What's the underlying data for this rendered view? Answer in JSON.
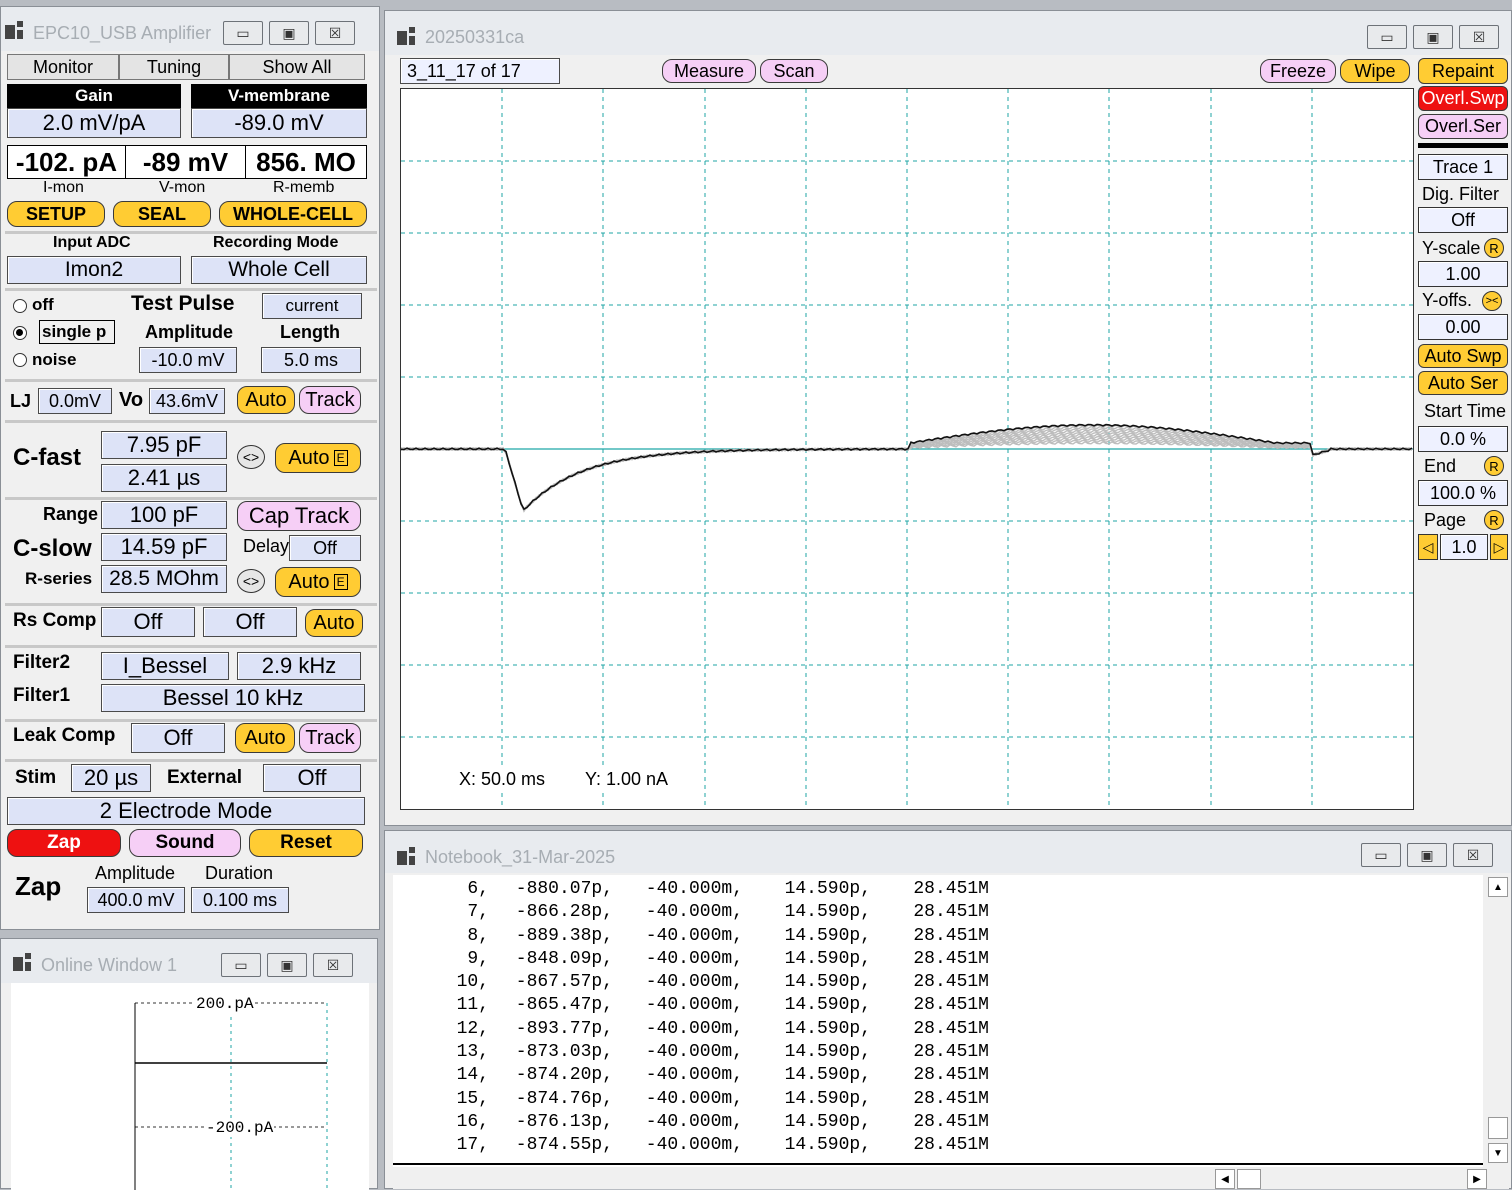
{
  "amplifier": {
    "title": "EPC10_USB Amplifier",
    "tabs": [
      "Monitor",
      "Tuning",
      "Show All"
    ],
    "gain_label": "Gain",
    "gain_value": "2.0 mV/pA",
    "vmem_label": "V-membrane",
    "vmem_value": "-89.0 mV",
    "imon_value": "-102. pA",
    "vmon_value": "-89 mV",
    "rmemb_value": "856. MO",
    "imon_label": "I-mon",
    "vmon_label": "V-mon",
    "rmemb_label": "R-memb",
    "mode_setup": "SETUP",
    "mode_seal": "SEAL",
    "mode_whole": "WHOLE-CELL",
    "input_adc_label": "Input ADC",
    "input_adc_value": "Imon2",
    "rec_mode_label": "Recording Mode",
    "rec_mode_value": "Whole Cell",
    "tp_off": "off",
    "tp_single": "single p",
    "tp_noise": "noise",
    "tp_title": "Test Pulse",
    "tp_current": "current",
    "tp_amp_label": "Amplitude",
    "tp_len_label": "Length",
    "tp_amp_value": "-10.0 mV",
    "tp_len_value": "5.0 ms",
    "lj_label": "LJ",
    "lj_value": "0.0mV",
    "vo_label": "Vo",
    "vo_value": "43.6mV",
    "auto": "Auto",
    "track": "Track",
    "cfast_label": "C-fast",
    "cfast_value": "7.95 pF",
    "cfast_tau": "2.41 µs",
    "arrows": "<>",
    "auto_e": "E",
    "range_label": "Range",
    "range_value": "100 pF",
    "cap_track": "Cap Track",
    "cslow_label": "C-slow",
    "cslow_value": "14.59 pF",
    "delay_label": "Delay",
    "delay_value": "Off",
    "rseries_label": "R-series",
    "rseries_value": "28.5 MOhm",
    "rscomp_label": "Rs Comp",
    "rscomp_value1": "Off",
    "rscomp_value2": "Off",
    "filter2_label": "Filter2",
    "filter2_type": "I_Bessel",
    "filter2_freq": "2.9 kHz",
    "filter1_label": "Filter1",
    "filter1_value": "Bessel 10 kHz",
    "leak_label": "Leak Comp",
    "leak_value": "Off",
    "stim_label": "Stim",
    "stim_value": "20 µs",
    "external_label": "External",
    "external_value": "Off",
    "electrode_mode": "2 Electrode Mode",
    "zap_btn": "Zap",
    "sound_btn": "Sound",
    "reset_btn": "Reset",
    "zap_label": "Zap",
    "zap_amp_label": "Amplitude",
    "zap_dur_label": "Duration",
    "zap_amp_value": "400.0 mV",
    "zap_dur_value": "0.100 ms"
  },
  "online": {
    "title": "Online Window 1",
    "top_label": "200.pA",
    "bottom_label": "-200.pA"
  },
  "oscilloscope": {
    "title": "20250331ca",
    "series": "3_11_17 of 17",
    "measure": "Measure",
    "scan": "Scan",
    "freeze": "Freeze",
    "wipe": "Wipe",
    "repaint": "Repaint",
    "overl_swp": "Overl.Swp",
    "overl_ser": "Overl.Ser",
    "trace": "Trace 1",
    "dig_filter": "Dig. Filter",
    "dig_filter_value": "Off",
    "yscale": "Y-scale",
    "yscale_value": "1.00",
    "yoffs": "Y-offs.",
    "yoffs_value": "0.00",
    "auto_swp": "Auto Swp",
    "auto_ser": "Auto Ser",
    "start_time": "Start Time",
    "start_value": "0.0 %",
    "end_label": "End",
    "end_value": "100.0 %",
    "page_label": "Page",
    "page_value": "1.0",
    "r": "R",
    "x_readout": "X: 50.0 ms",
    "y_readout": "Y: 1.00 nA"
  },
  "notebook": {
    "title": "Notebook_31-Mar-2025",
    "rows": [
      [
        "6,",
        "-880.07p,",
        "-40.000m,",
        "14.590p,",
        "28.451M"
      ],
      [
        "7,",
        "-866.28p,",
        "-40.000m,",
        "14.590p,",
        "28.451M"
      ],
      [
        "8,",
        "-889.38p,",
        "-40.000m,",
        "14.590p,",
        "28.451M"
      ],
      [
        "9,",
        "-848.09p,",
        "-40.000m,",
        "14.590p,",
        "28.451M"
      ],
      [
        "10,",
        "-867.57p,",
        "-40.000m,",
        "14.590p,",
        "28.451M"
      ],
      [
        "11,",
        "-865.47p,",
        "-40.000m,",
        "14.590p,",
        "28.451M"
      ],
      [
        "12,",
        "-893.77p,",
        "-40.000m,",
        "14.590p,",
        "28.451M"
      ],
      [
        "13,",
        "-873.03p,",
        "-40.000m,",
        "14.590p,",
        "28.451M"
      ],
      [
        "14,",
        "-874.20p,",
        "-40.000m,",
        "14.590p,",
        "28.451M"
      ],
      [
        "15,",
        "-874.76p,",
        "-40.000m,",
        "14.590p,",
        "28.451M"
      ],
      [
        "16,",
        "-876.13p,",
        "-40.000m,",
        "14.590p,",
        "28.451M"
      ],
      [
        "17,",
        "-874.55p,",
        "-40.000m,",
        "14.590p,",
        "28.451M"
      ]
    ]
  },
  "window_buttons": {
    "minimize": "▭",
    "maximize": "▣",
    "close": "☒"
  }
}
